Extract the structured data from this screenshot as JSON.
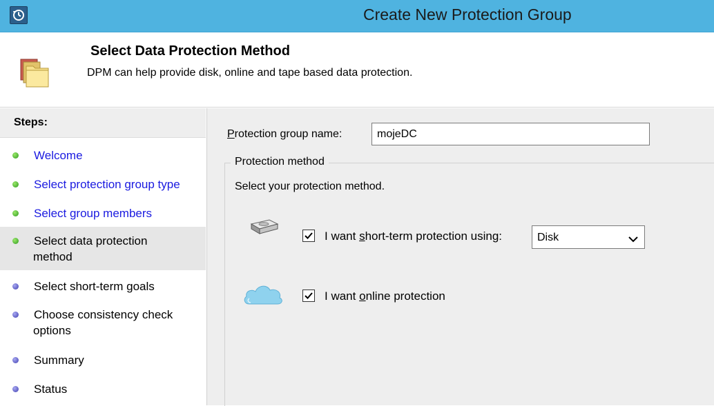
{
  "window": {
    "title": "Create New Protection Group",
    "app_icon": "dpm-clock-icon"
  },
  "header": {
    "title": "Select Data Protection Method",
    "subtitle": "DPM can help provide disk, online and tape based data protection.",
    "icon": "folders-icon"
  },
  "steps": {
    "heading": "Steps:",
    "items": [
      {
        "line1": "Welcome",
        "line2": "",
        "status": "completed"
      },
      {
        "line1": "Select protection group type",
        "line2": "",
        "status": "completed"
      },
      {
        "line1": "Select group members",
        "line2": "",
        "status": "completed"
      },
      {
        "line1": "Select data protection",
        "line2": "method",
        "status": "current"
      },
      {
        "line1": "Select short-term goals",
        "line2": "",
        "status": "pending"
      },
      {
        "line1": "Choose consistency check",
        "line2": "options",
        "status": "pending"
      },
      {
        "line1": "Summary",
        "line2": "",
        "status": "pending"
      },
      {
        "line1": "Status",
        "line2": "",
        "status": "pending"
      }
    ]
  },
  "form": {
    "group_name_label_a": "P",
    "group_name_label_b": "rotection group name:",
    "group_name_value": "mojeDC",
    "method_legend": "Protection method",
    "method_prompt": "Select your protection method.",
    "short_term": {
      "label_a": "I want ",
      "label_b": "s",
      "label_c": "hort-term protection using:",
      "checked": true,
      "icon": "disk-drive-icon",
      "selected": "Disk"
    },
    "online": {
      "label_a": "I want ",
      "label_b": "o",
      "label_c": "nline protection",
      "checked": true,
      "icon": "cloud-icon"
    }
  },
  "colors": {
    "titlebar": "#4fb3e0",
    "link": "#1a1ae0",
    "completed_dot": "#3fa82a",
    "pending_dot": "#4a4ab8",
    "current_step_bg": "#e6e6e6",
    "main_pane_bg": "#eeeeee"
  }
}
